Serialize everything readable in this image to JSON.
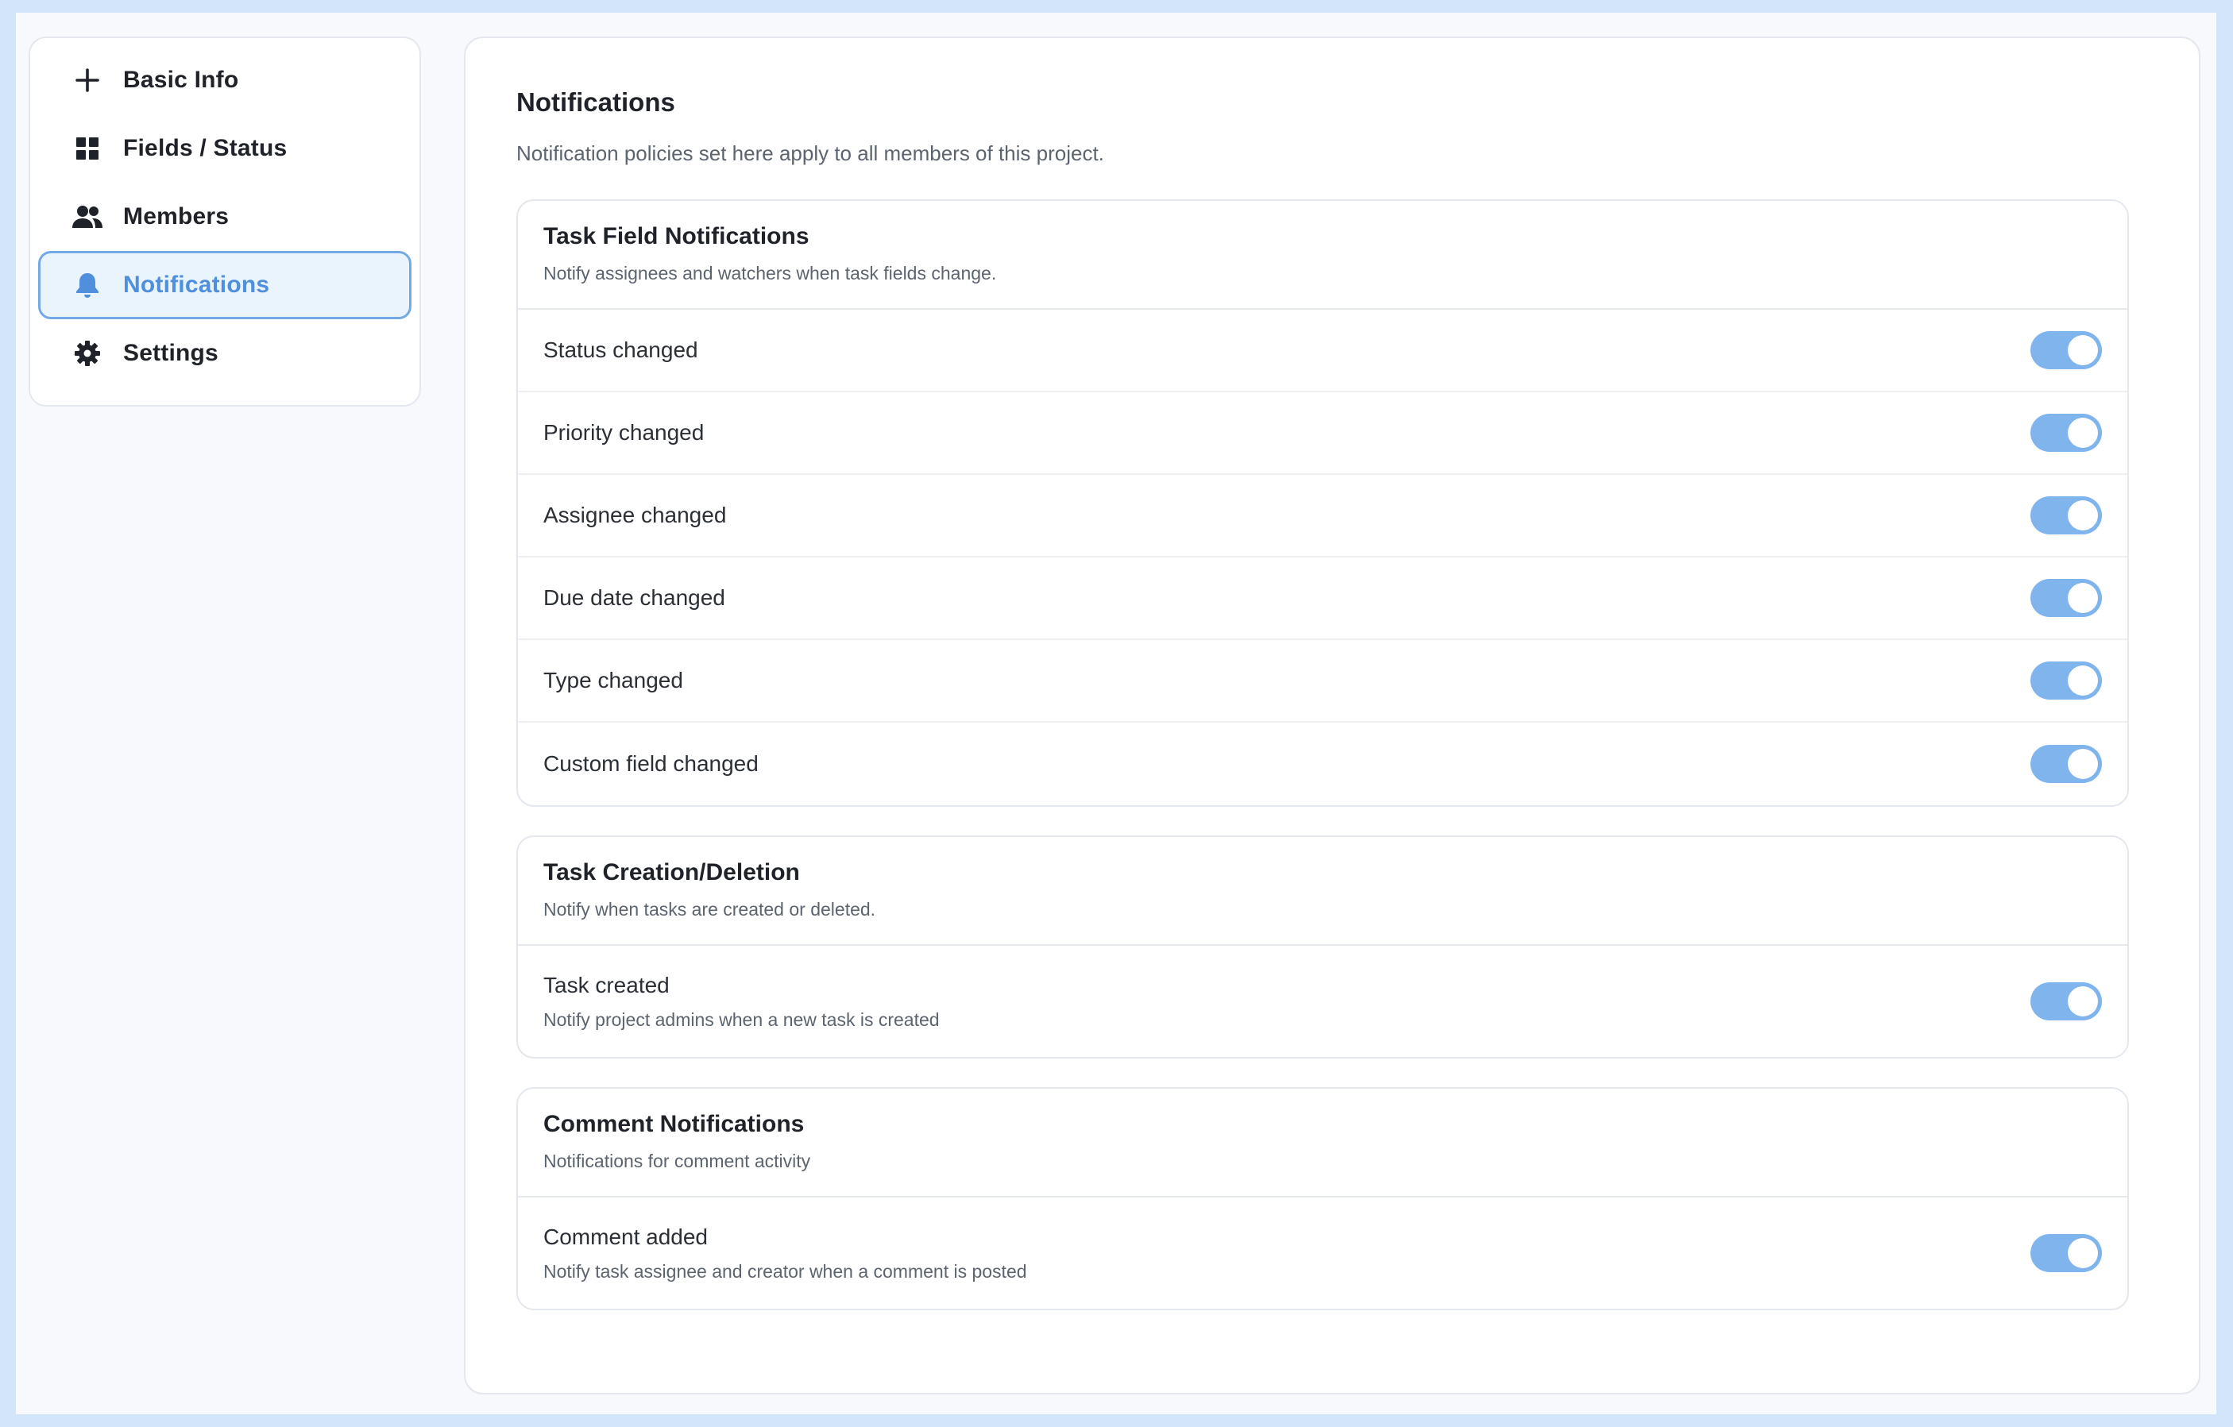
{
  "sidebar": {
    "items": [
      {
        "label": "Basic Info",
        "icon": "plus-icon",
        "active": false
      },
      {
        "label": "Fields / Status",
        "icon": "grid-icon",
        "active": false
      },
      {
        "label": "Members",
        "icon": "users-icon",
        "active": false
      },
      {
        "label": "Notifications",
        "icon": "bell-icon",
        "active": true
      },
      {
        "label": "Settings",
        "icon": "gear-icon",
        "active": false
      }
    ]
  },
  "main": {
    "title": "Notifications",
    "description": "Notification policies set here apply to all members of this project.",
    "sections": [
      {
        "title": "Task Field Notifications",
        "subtitle": "Notify assignees and watchers when task fields change.",
        "rows": [
          {
            "label": "Status changed",
            "enabled": true
          },
          {
            "label": "Priority changed",
            "enabled": true
          },
          {
            "label": "Assignee changed",
            "enabled": true
          },
          {
            "label": "Due date changed",
            "enabled": true
          },
          {
            "label": "Type changed",
            "enabled": true
          },
          {
            "label": "Custom field changed",
            "enabled": true
          }
        ]
      },
      {
        "title": "Task Creation/Deletion",
        "subtitle": "Notify when tasks are created or deleted.",
        "rows": [
          {
            "label": "Task created",
            "description": "Notify project admins when a new task is created",
            "enabled": true
          }
        ]
      },
      {
        "title": "Comment Notifications",
        "subtitle": "Notifications for comment activity",
        "rows": [
          {
            "label": "Comment added",
            "description": "Notify task assignee and creator when a comment is posted",
            "enabled": true
          }
        ]
      }
    ]
  },
  "colors": {
    "accent": "#4f8fdc",
    "toggle_on": "#80b4ec",
    "active_bg": "#e9f4fd",
    "page_bg": "#d3e5fb"
  }
}
